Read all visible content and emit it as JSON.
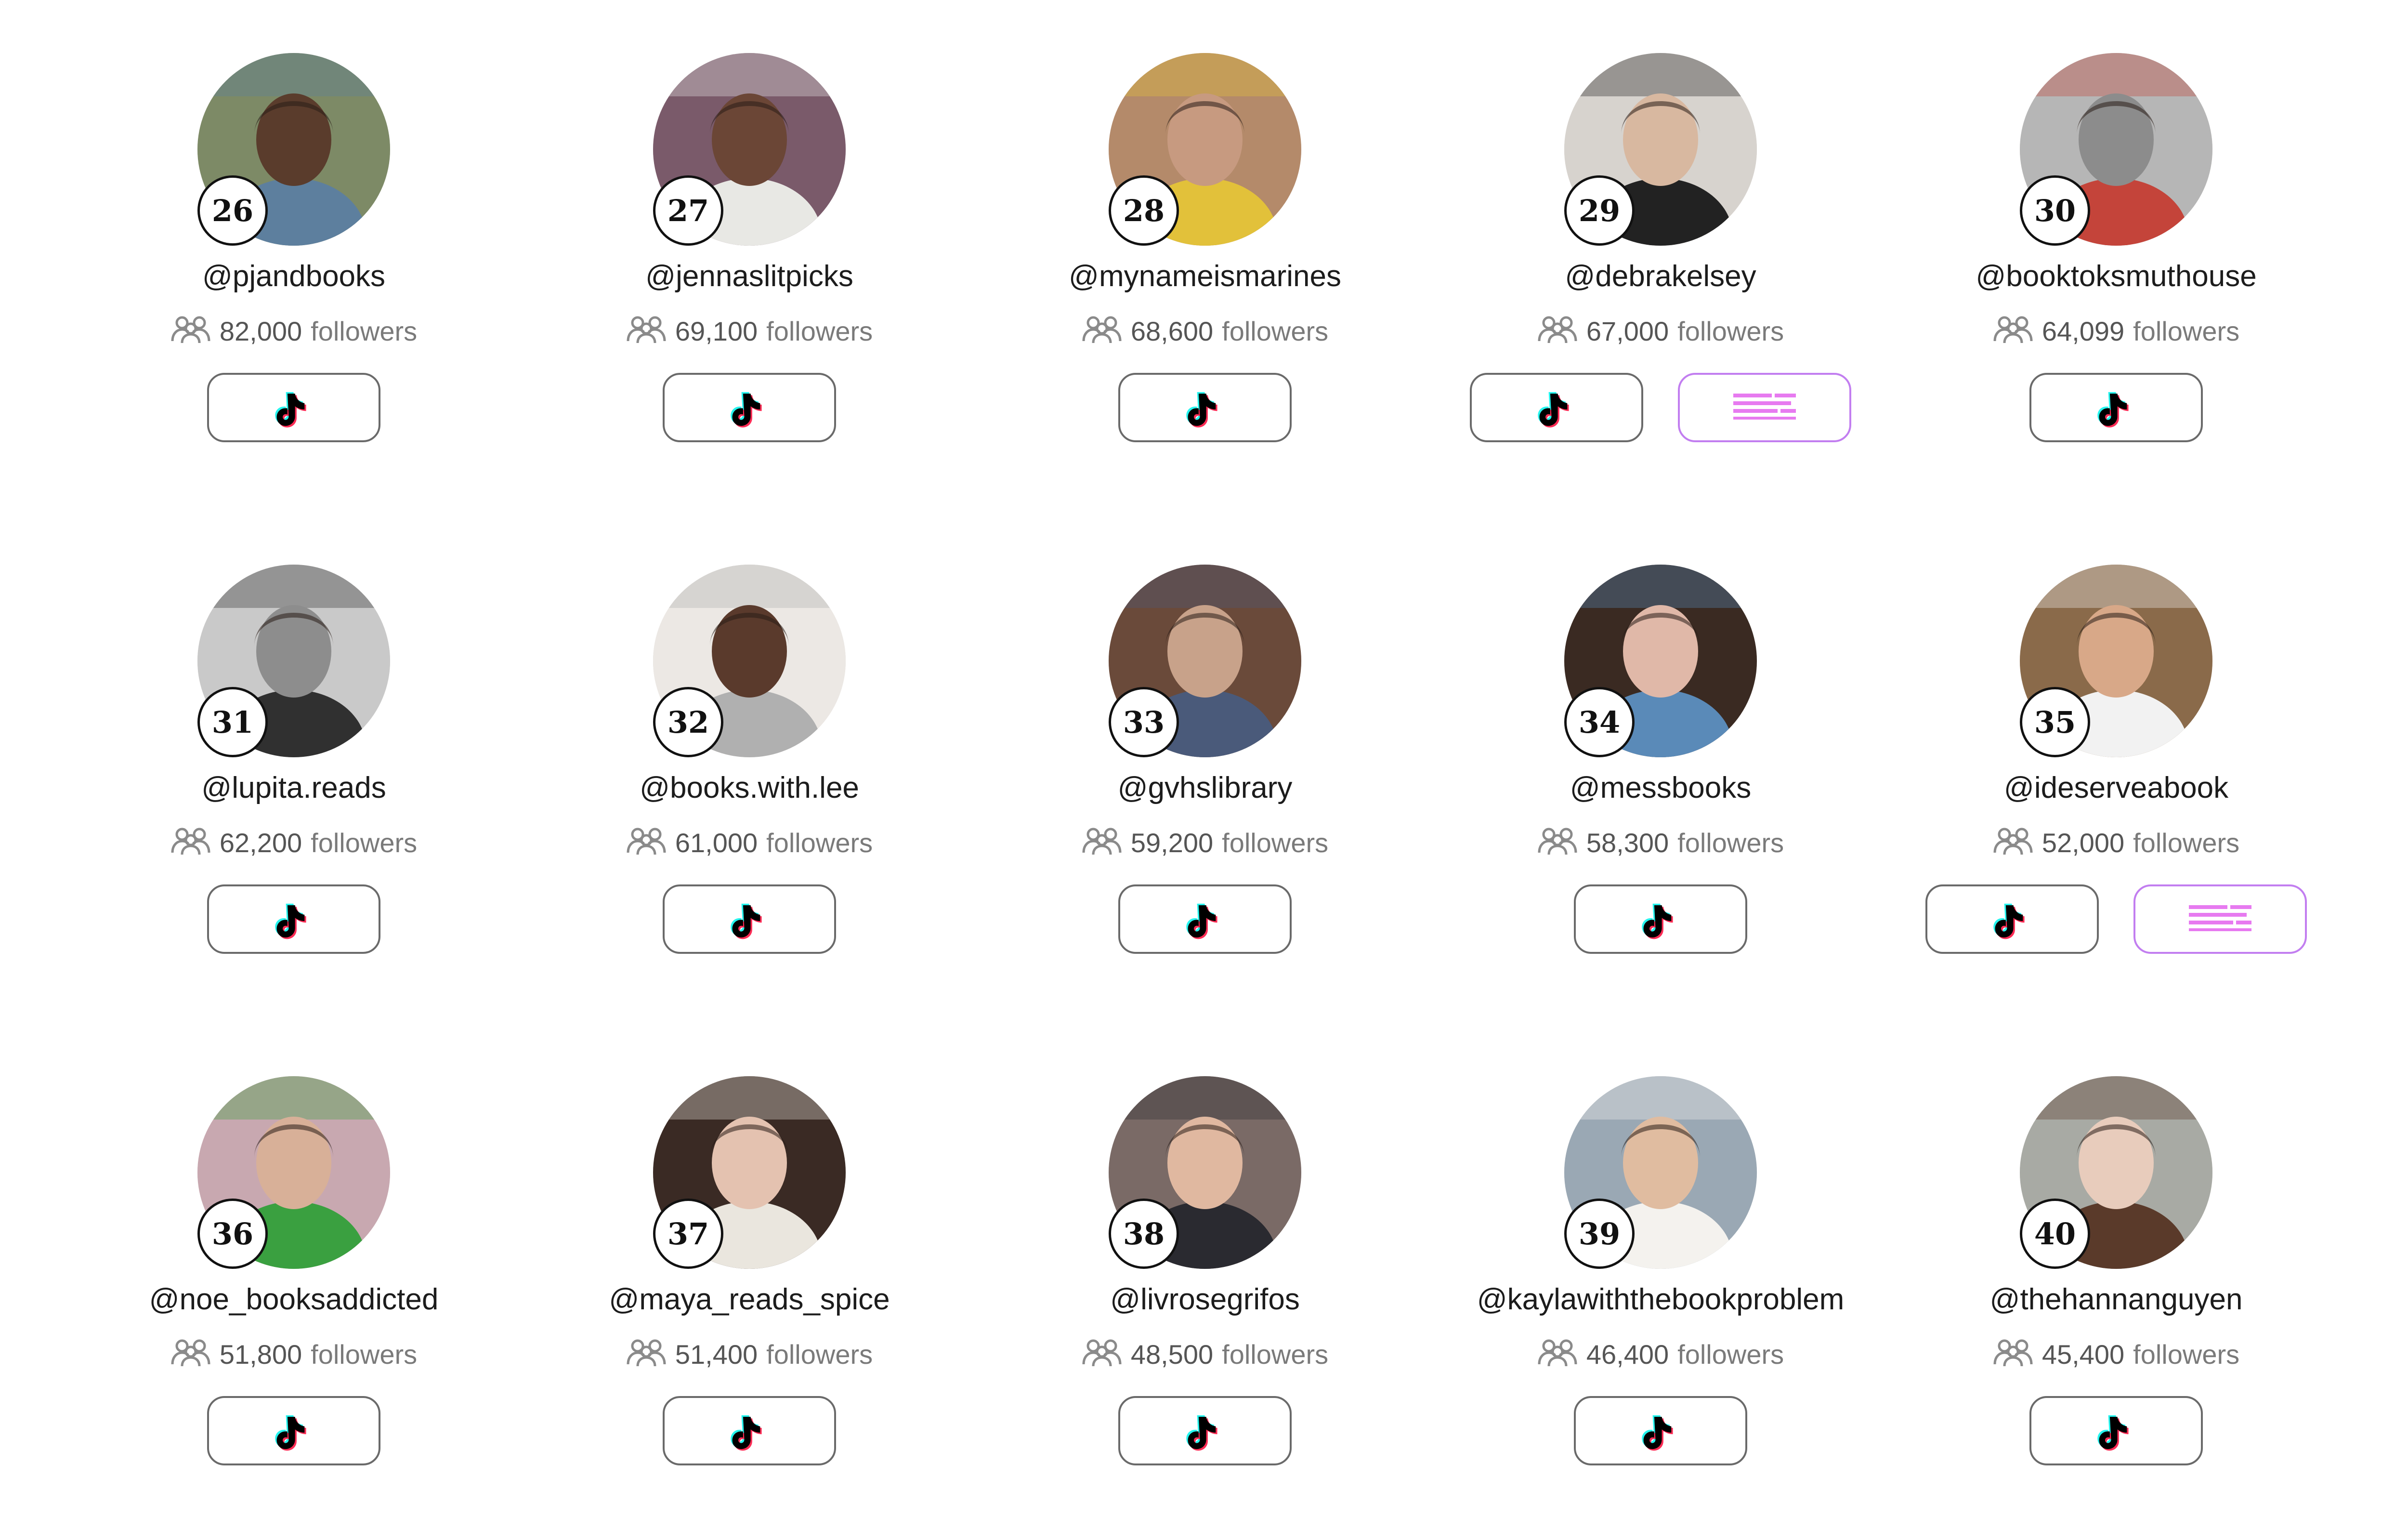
{
  "creators": [
    {
      "rank": "26",
      "handle": "@pjandbooks",
      "count": "82,000",
      "followers_label": "followers",
      "has_second_link": false,
      "avatar": {
        "bg": "#7d8a66",
        "skin": "#5a3c2c",
        "accent": "#5d7f9e"
      }
    },
    {
      "rank": "27",
      "handle": "@jennaslitpicks",
      "count": "69,100",
      "followers_label": "followers",
      "has_second_link": false,
      "avatar": {
        "bg": "#7a5a6a",
        "skin": "#6b4636",
        "accent": "#e8e8e4"
      }
    },
    {
      "rank": "28",
      "handle": "@mynameismarines",
      "count": "68,600",
      "followers_label": "followers",
      "has_second_link": false,
      "avatar": {
        "bg": "#b48a6a",
        "skin": "#c79a80",
        "accent": "#e2c13a"
      }
    },
    {
      "rank": "29",
      "handle": "@debrakelsey",
      "count": "67,000",
      "followers_label": "followers",
      "has_second_link": true,
      "avatar": {
        "bg": "#d7d3ce",
        "skin": "#d8b8a0",
        "accent": "#222222"
      }
    },
    {
      "rank": "30",
      "handle": "@booktoksmuthouse",
      "count": "64,099",
      "followers_label": "followers",
      "has_second_link": false,
      "avatar": {
        "bg": "#b6b6b6",
        "skin": "#8c8c8c",
        "accent": "#c4443a"
      }
    },
    {
      "rank": "31",
      "handle": "@lupita.reads",
      "count": "62,200",
      "followers_label": "followers",
      "has_second_link": false,
      "avatar": {
        "bg": "#c9c9c9",
        "skin": "#8d8d8d",
        "accent": "#303030"
      }
    },
    {
      "rank": "32",
      "handle": "@books.with.lee",
      "count": "61,000",
      "followers_label": "followers",
      "has_second_link": false,
      "avatar": {
        "bg": "#ece8e4",
        "skin": "#5a3a2c",
        "accent": "#b0b0b0"
      }
    },
    {
      "rank": "33",
      "handle": "@gvhslibrary",
      "count": "59,200",
      "followers_label": "followers",
      "has_second_link": false,
      "avatar": {
        "bg": "#6a4a3a",
        "skin": "#c8a28a",
        "accent": "#4a5a7a"
      }
    },
    {
      "rank": "34",
      "handle": "@messbooks",
      "count": "58,300",
      "followers_label": "followers",
      "has_second_link": false,
      "avatar": {
        "bg": "#3a2a22",
        "skin": "#e0b8a8",
        "accent": "#5a8ab8"
      }
    },
    {
      "rank": "35",
      "handle": "@ideserveabook",
      "count": "52,000",
      "followers_label": "followers",
      "has_second_link": true,
      "avatar": {
        "bg": "#8a6a4a",
        "skin": "#d8a888",
        "accent": "#f2f2f2"
      }
    },
    {
      "rank": "36",
      "handle": "@noe_booksaddicted",
      "count": "51,800",
      "followers_label": "followers",
      "has_second_link": false,
      "avatar": {
        "bg": "#c8a8b0",
        "skin": "#d8b098",
        "accent": "#3aa040"
      }
    },
    {
      "rank": "37",
      "handle": "@maya_reads_spice",
      "count": "51,400",
      "followers_label": "followers",
      "has_second_link": false,
      "avatar": {
        "bg": "#3a2a24",
        "skin": "#e4c2b0",
        "accent": "#eae6de"
      }
    },
    {
      "rank": "38",
      "handle": "@livrosegrifos",
      "count": "48,500",
      "followers_label": "followers",
      "has_second_link": false,
      "avatar": {
        "bg": "#7a6a66",
        "skin": "#e0b8a0",
        "accent": "#2a2a30"
      }
    },
    {
      "rank": "39",
      "handle": "@kaylawiththebookproblem",
      "count": "46,400",
      "followers_label": "followers",
      "has_second_link": false,
      "avatar": {
        "bg": "#9aa8b4",
        "skin": "#e0bca0",
        "accent": "#f4f2ee"
      }
    },
    {
      "rank": "40",
      "handle": "@thehannanguyen",
      "count": "45,400",
      "followers_label": "followers",
      "has_second_link": false,
      "avatar": {
        "bg": "#a8aaa4",
        "skin": "#e8ccbc",
        "accent": "#5a3a2a"
      }
    }
  ],
  "colors": {
    "tiktok_cyan": "#25F4EE",
    "tiktok_red": "#FE2C55",
    "tiktok_black": "#000000",
    "alt_link_pink": "#e77af0",
    "alt_link_border": "#c27ef0"
  },
  "icons": {
    "followers": "people-group-icon",
    "primary_link": "tiktok-icon",
    "secondary_link": "bars-logo-icon"
  }
}
